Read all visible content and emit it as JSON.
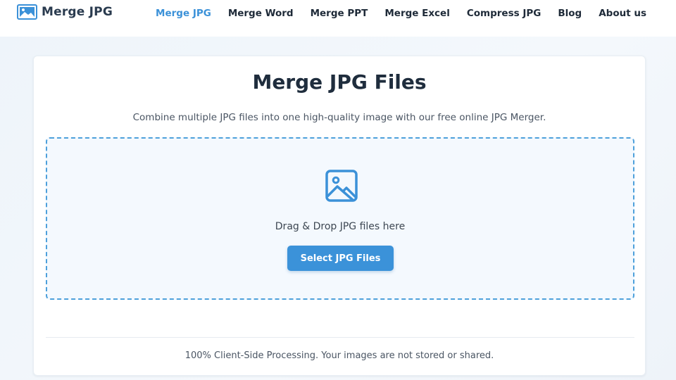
{
  "header": {
    "brand": "Merge JPG",
    "brand_icon": "image-icon",
    "nav": [
      {
        "label": "Merge JPG",
        "active": true
      },
      {
        "label": "Merge Word",
        "active": false
      },
      {
        "label": "Merge PPT",
        "active": false
      },
      {
        "label": "Merge Excel",
        "active": false
      },
      {
        "label": "Compress JPG",
        "active": false
      },
      {
        "label": "Blog",
        "active": false
      },
      {
        "label": "About us",
        "active": false
      }
    ]
  },
  "main": {
    "title": "Merge JPG Files",
    "subtitle": "Combine multiple JPG files into one high-quality image with our free online JPG Merger.",
    "dropzone": {
      "icon": "image-icon",
      "text": "Drag & Drop JPG files here",
      "button_label": "Select JPG Files"
    },
    "footer_note": "100% Client-Side Processing. Your images are not stored or shared."
  },
  "colors": {
    "accent": "#3b92d9",
    "text_dark": "#1f2d3d",
    "dropzone_border": "#4da0db"
  }
}
